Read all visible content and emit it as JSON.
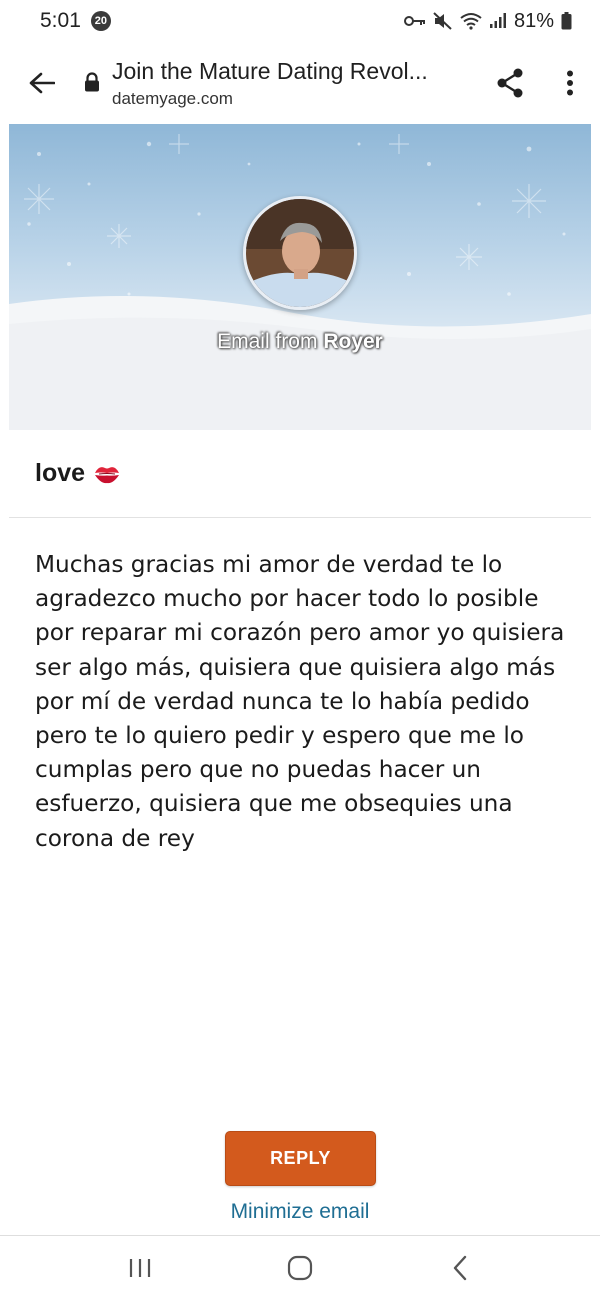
{
  "status_bar": {
    "time": "5:01",
    "notification_count": "20",
    "battery": "81%"
  },
  "browser": {
    "page_title": "Join the Mature Dating Revol...",
    "domain": "datemyage.com"
  },
  "header": {
    "email_from_prefix": "Email from",
    "sender_name": "Royer"
  },
  "message": {
    "subject": "love",
    "body": "Muchas gracias mi amor de verdad te lo agradezco mucho por hacer todo lo posible por reparar mi corazón pero amor yo quisiera ser algo más, quisiera que quisiera algo más por mí de verdad nunca te lo había pedido pero te lo quiero pedir y espero que me lo cumplas pero que no puedas hacer un esfuerzo, quisiera que me obsequies una corona de rey"
  },
  "actions": {
    "reply_label": "REPLY",
    "minimize_label": "Minimize email"
  },
  "colors": {
    "reply_button": "#d35a1d",
    "link": "#1f6e93"
  },
  "icons": {
    "subject_emoji": "kiss-mark-icon"
  }
}
